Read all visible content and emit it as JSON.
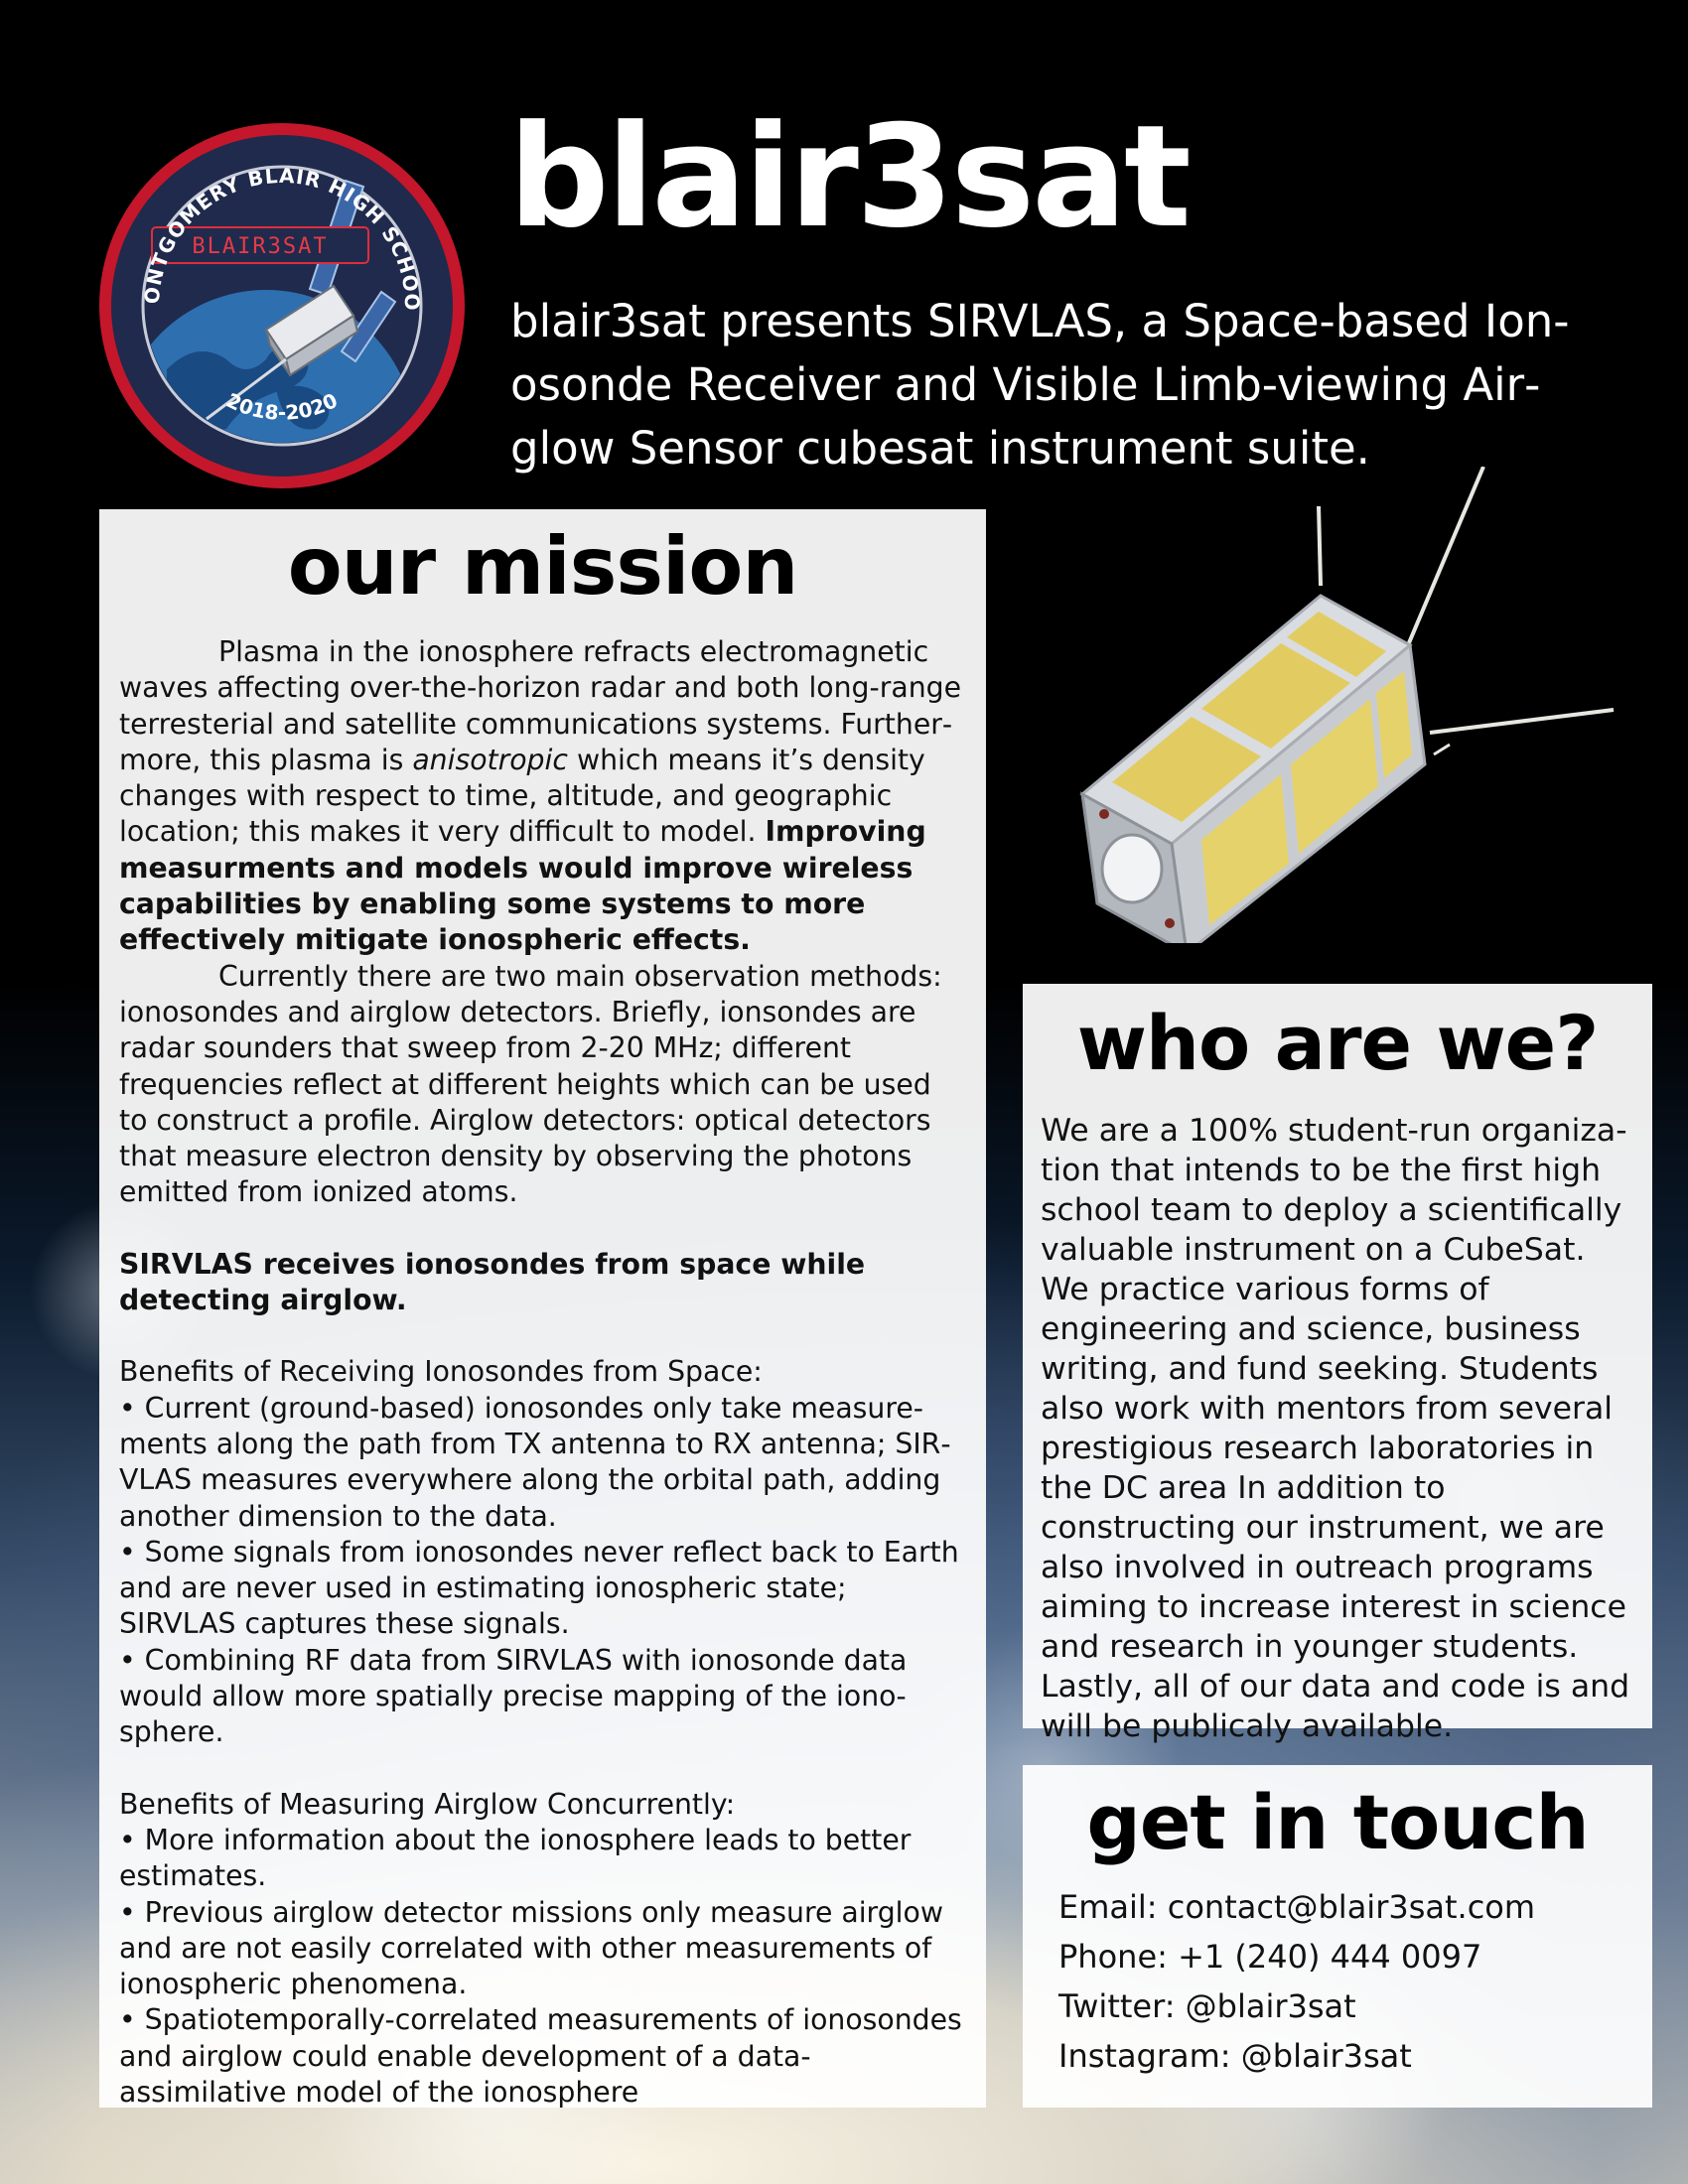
{
  "header": {
    "title": "blair3sat",
    "subtitle": "blair3sat presents SIRVLAS, a Space-based Ion­osonde Receiver and Visible Limb-viewing Air­glow Sensor cubesat instrument suite."
  },
  "logo": {
    "arc_top": "MONTGOMERY BLAIR HIGH SCHOOL",
    "badge": "BLAIR3SAT",
    "years": "2018-2020",
    "colors": {
      "ring": "#c4172b",
      "inner": "#1f2a4d",
      "ocean": "#2e6fb0"
    }
  },
  "mission": {
    "heading": "our mission",
    "p1_text": "Plasma in the ionosphere refracts electromagnetic waves affecting over-the-horizon radar and both long-range terresterial and satellite communications systems. Further­more, this plasma is ",
    "p1_em": "anisotropic",
    "p1_text2": " which means it’s density changes with respect to time, altitude, and geographic loca­tion; this makes it very difficult to model. ",
    "p1_bold": "Improving measur­ments and models would improve wireless capabilities by en­abling some systems to more effectively mitigate ionospheric effects.",
    "p2": "Currently there are two main observation methods: ionosondes and airglow detectors. Briefly, ionsondes are radar sounders that sweep from 2-20 MHz; different frequencies re­flect at different heights which can be used to construct a pro­file. Airglow detectors: optical detectors that measure electron density by observing the photons emitted from ionized atoms.",
    "p3_bold": "SIRVLAS receives ionosondes from space while detecting airglow.",
    "benefits_iono_title": "Benefits of Receiving Ionosondes from Space:",
    "benefits_iono": [
      "• Current (ground-based) ionosondes only take measure­ments along the path from TX antenna to RX antenna; SIR­VLAS measures everywhere along the orbital path, adding another dimension to the data.",
      "• Some signals from ionosondes never reflect back to Earth and are never used in estimating ionospheric state; SIRVLAS captures these signals.",
      "• Combining RF data from SIRVLAS with ionosonde data would allow more spatially precise mapping of the iono­sphere."
    ],
    "benefits_airglow_title": "Benefits of Measuring Airglow Concurrently:",
    "benefits_airglow": [
      "• More information about the ionosphere leads to better estimates.",
      "• Previous airglow detector missions only measure airglow and are not easily correlated with other measurements of ionospheric phenomena.",
      "• Spatiotemporally-correlated measurements of ionosondes and airglow could enable development of a data-assimilative model of the ionosphere"
    ]
  },
  "who": {
    "heading": "who are we?",
    "body": "We are a 100% student-run organiza­tion that intends to be the first high school team to deploy a scientifically valuable instrument on a CubeSat. We practice various forms of engineering and science, business writing, and fund seeking. Students also work with men­tors from several prestigious research laboratories in the DC area In addition to constructing our instrument, we are also involved in outreach programs aiming to increase interest in science and research in younger students. Last­ly, all of our data and code is and will be publicaly available."
  },
  "contact": {
    "heading": "get in touch",
    "email": "Email: contact@blair3sat.com",
    "phone": "Phone: +1 (240) 444 0097",
    "twitter": "Twitter: @blair3sat",
    "instagram": "Instagram: @blair3sat"
  },
  "colors": {
    "panel_bg": "#ffffff",
    "solar_panel": "#e2cc62",
    "frame": "#cfd3d8"
  }
}
